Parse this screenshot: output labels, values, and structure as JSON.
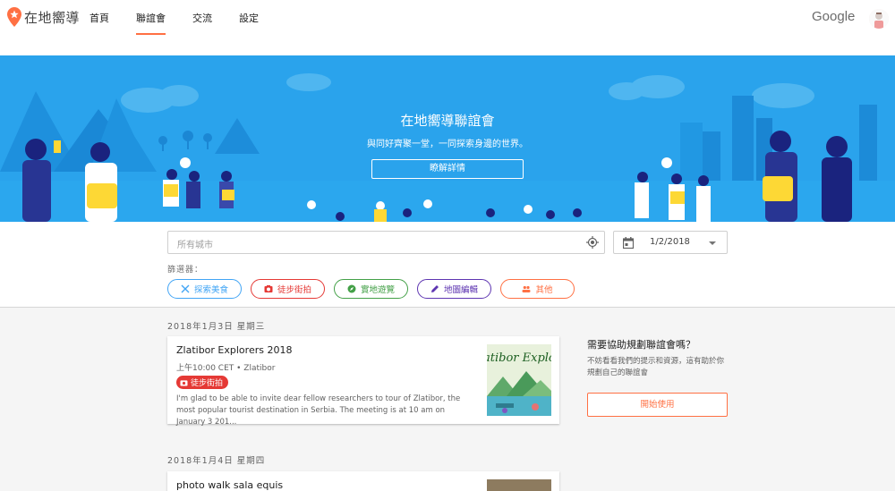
{
  "app": {
    "name": "在地嚮導"
  },
  "nav": {
    "items": [
      {
        "label": "首頁"
      },
      {
        "label": "聯誼會"
      },
      {
        "label": "交流"
      },
      {
        "label": "設定"
      }
    ],
    "active": "聯誼會"
  },
  "google_label": "Google",
  "hero": {
    "title": "在地嚮導聯誼會",
    "subtitle": "與同好齊聚一堂，一同探索身邊的世界。",
    "button": "瞭解詳情"
  },
  "search": {
    "placeholder": "所有城市",
    "date": "1/2/2018"
  },
  "filters": {
    "label": "篩選器：",
    "chips": [
      {
        "label": "探索美食",
        "color": "#42a5f5",
        "icon": "food-icon"
      },
      {
        "label": "徒步街拍",
        "color": "#e53935",
        "icon": "camera-icon"
      },
      {
        "label": "實地遊覽",
        "color": "#43a047",
        "icon": "compass-icon"
      },
      {
        "label": "地圖編輯",
        "color": "#5e35b1",
        "icon": "pencil-icon"
      },
      {
        "label": "其他",
        "color": "#ff7043",
        "icon": "group-icon"
      }
    ]
  },
  "events": [
    {
      "date_heading": "2018年1月3日 星期三",
      "title": "Zlatibor Explorers 2018",
      "time": "上午10:00 CET • Zlatibor",
      "tag": "徒步街拍",
      "description": "I'm glad to be able to invite dear fellow researchers to tour of Zlatibor, the most popular tourist destination in Serbia. The meeting is at 10 am on January 3 201...",
      "image_text": "atibor Explo"
    },
    {
      "date_heading": "2018年1月4日 星期四",
      "title": "photo walk sala equis"
    }
  ],
  "sidebar": {
    "title": "需要協助規劃聯誼會嗎？",
    "text": "不妨看看我們的提示和資源，這有助於你規劃自己的聯誼會",
    "button": "開始使用"
  },
  "colors": {
    "accent": "#ff7043",
    "hero": "#2aa3ec"
  }
}
